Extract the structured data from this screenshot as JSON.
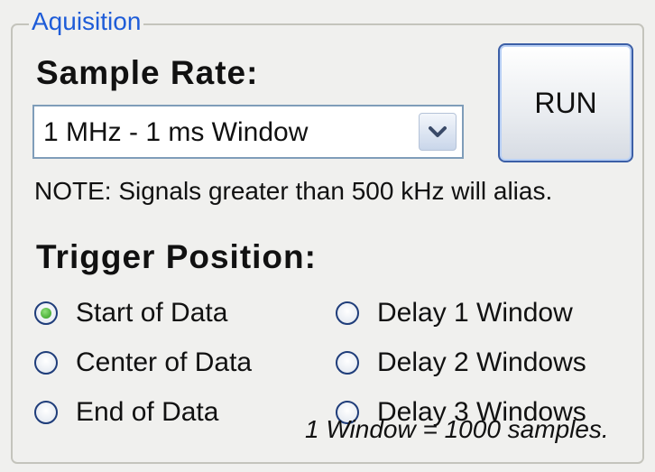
{
  "group": {
    "title": "Aquisition"
  },
  "sample_rate": {
    "heading": "Sample Rate:",
    "selected_value": "1 MHz - 1 ms Window",
    "note": "NOTE: Signals greater than 500 kHz will alias."
  },
  "run_button": {
    "label": "RUN"
  },
  "trigger": {
    "heading": "Trigger Position:",
    "options": [
      {
        "label": "Start of Data",
        "checked": true
      },
      {
        "label": "Center of Data",
        "checked": false
      },
      {
        "label": "End of Data",
        "checked": false
      },
      {
        "label": "Delay 1 Window",
        "checked": false
      },
      {
        "label": "Delay 2 Windows",
        "checked": false
      },
      {
        "label": "Delay 3 Windows",
        "checked": false
      }
    ],
    "footnote": "1 Window = 1000 samples."
  },
  "icons": {
    "dropdown": "chevron-down-icon",
    "radio_selected": "radio-selected-icon",
    "radio_unselected": "radio-unselected-icon"
  },
  "colors": {
    "group_title": "#1e5cd8",
    "radio_selected_dot": "#2e9a1c",
    "run_border": "#3c5fa6"
  }
}
